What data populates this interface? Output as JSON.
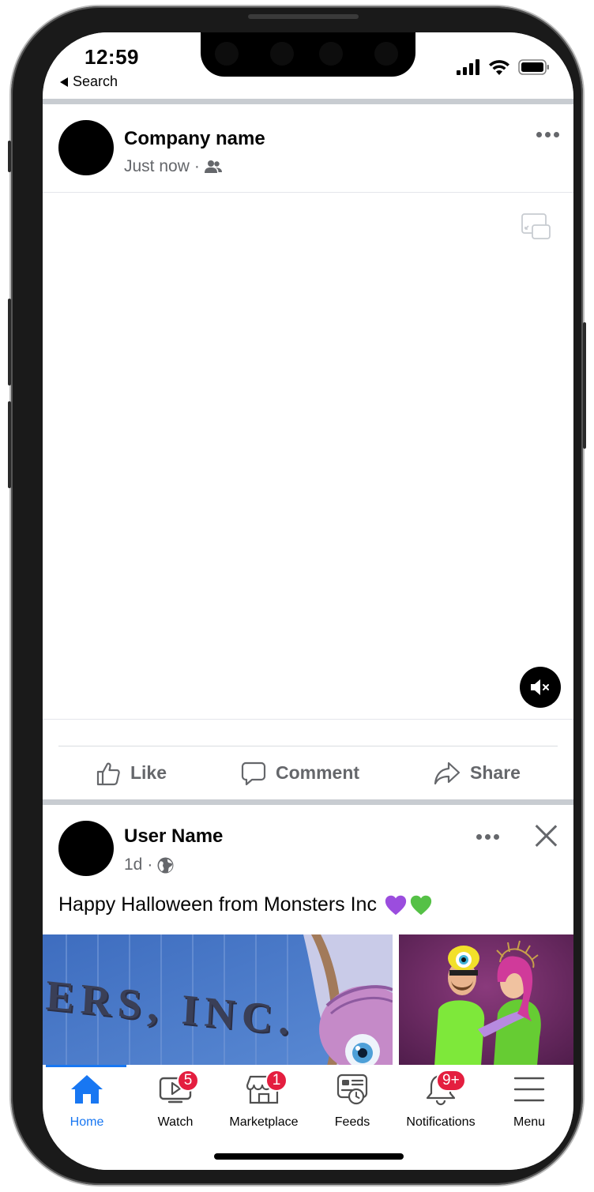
{
  "status_bar": {
    "time": "12:59",
    "back_label": "Search"
  },
  "post1": {
    "author": "Company name",
    "timestamp": "Just now",
    "separator": "·",
    "audience_icon": "friends-icon",
    "actions": {
      "like": "Like",
      "comment": "Comment",
      "share": "Share"
    }
  },
  "post2": {
    "author": "User Name",
    "timestamp": "1d",
    "separator": "·",
    "audience_icon": "globe-icon",
    "text": "Happy Halloween from Monsters Inc",
    "photo_left_sign": "ERS, INC."
  },
  "bottom_nav": {
    "items": [
      {
        "label": "Home",
        "icon": "home-icon",
        "badge": "",
        "active": true
      },
      {
        "label": "Watch",
        "icon": "video-icon",
        "badge": "5"
      },
      {
        "label": "Marketplace",
        "icon": "shop-icon",
        "badge": "1"
      },
      {
        "label": "Feeds",
        "icon": "feeds-icon",
        "badge": ""
      },
      {
        "label": "Notifications",
        "icon": "bell-icon",
        "badge": "9+"
      },
      {
        "label": "Menu",
        "icon": "hamburger-icon",
        "badge": ""
      }
    ]
  },
  "colors": {
    "accent": "#1877f2",
    "badge": "#e41e3f",
    "secondary_text": "#65676b",
    "divider": "#c8ccd1"
  }
}
